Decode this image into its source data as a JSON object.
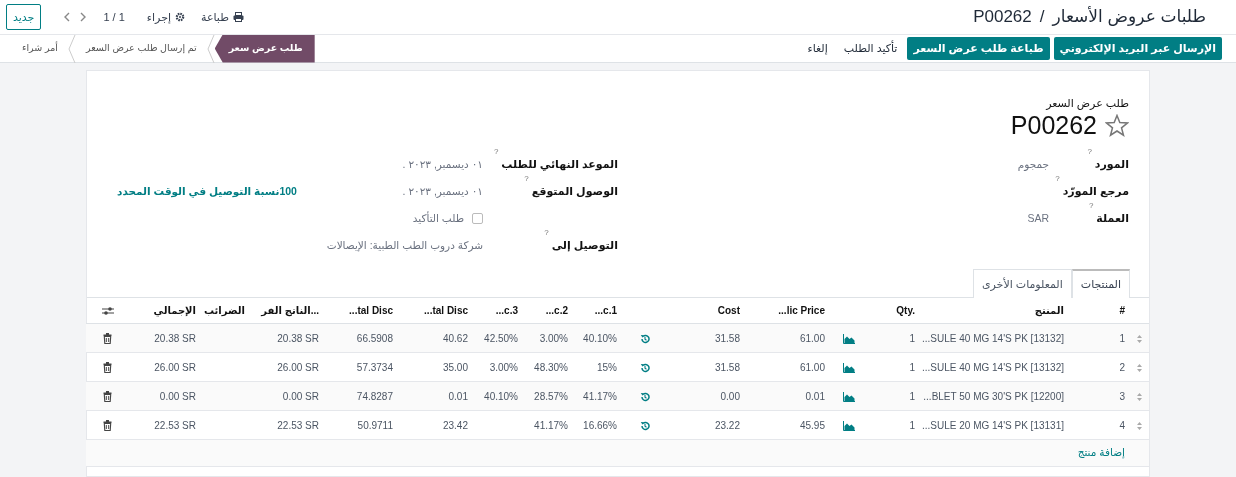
{
  "breadcrumb": {
    "parent": "طلبات عروض الأسعار",
    "separator": "/",
    "current": "P00262"
  },
  "toolbar": {
    "print": "طباعة",
    "action": "إجراء",
    "pager": "1 / 1",
    "new_button": "جديد"
  },
  "action_buttons": [
    {
      "label": "الإرسال عبر البريد الإلكتروني",
      "kind": "primary"
    },
    {
      "label": "طباعة طلب عرض السعر",
      "kind": "primary"
    },
    {
      "label": "تأكيد الطلب",
      "kind": "secondary"
    },
    {
      "label": "إلغاء",
      "kind": "secondary"
    }
  ],
  "status_steps": [
    {
      "label": "طلب عرض سعر",
      "selected": true
    },
    {
      "label": "تم إرسال طلب عرض السعر",
      "selected": false
    },
    {
      "label": "أمر شراء",
      "selected": false
    }
  ],
  "form": {
    "subtitle": "طلب عرض السعر",
    "title": "P00262",
    "starred": false,
    "right_fields": [
      {
        "label": "المورد",
        "help": "?",
        "value": "جمجوم"
      },
      {
        "label": "مرجع المورّد",
        "help": "?"
      },
      {
        "label": "العملة",
        "help": "?",
        "value": "SAR"
      }
    ],
    "left_fields": [
      {
        "kind": "text",
        "label": "الموعد النهائي للطلب",
        "help": "?",
        "value": "٠١ ديسمبر, ٢٠٢٣ ."
      },
      {
        "kind": "text",
        "label": "الوصول المتوقع",
        "help": "?",
        "value": "٠١ ديسمبر, ٢٠٢٣ .",
        "stat": "100نسبة التوصيل في الوقت المحدد"
      },
      {
        "kind": "checkbox",
        "label": "طلب التأكيد",
        "checked": false
      },
      {
        "kind": "text",
        "label": "التوصيل إلى",
        "help": "?",
        "value": "شركة دروب الطب الطبية: الإيصالات"
      }
    ]
  },
  "tabs": [
    {
      "label": "المنتجات",
      "selected": true
    },
    {
      "label": "المعلومات الأخرى",
      "selected": false
    }
  ],
  "table": {
    "columns": [
      {
        "kind": "handle"
      },
      {
        "kind": "text",
        "label": "#"
      },
      {
        "kind": "text",
        "label": "المنتج"
      },
      {
        "kind": "text",
        "label": "Qty."
      },
      {
        "kind": "chart"
      },
      {
        "kind": "text",
        "label": "...lic Price"
      },
      {
        "kind": "text",
        "label": "Cost"
      },
      {
        "kind": "history"
      },
      {
        "kind": "text",
        "label": "...c.1"
      },
      {
        "kind": "text",
        "label": "...c.2"
      },
      {
        "kind": "text",
        "label": "...c.3"
      },
      {
        "kind": "text",
        "label": "...tal Disc"
      },
      {
        "kind": "text",
        "label": "...tal Disc"
      },
      {
        "kind": "text",
        "label": "...الناتج الفر"
      },
      {
        "kind": "text",
        "label": "الضرائب"
      },
      {
        "kind": "text",
        "label": "الإجمالي"
      },
      {
        "kind": "delete"
      }
    ],
    "rows": [
      {
        "cells": [
          "",
          "1",
          "...SULE 40 MG 14'S PK [13132]",
          "1",
          "",
          "61.00",
          "31.58",
          "",
          "40.10%",
          "3.00%",
          "42.50%",
          "40.62",
          "66.5908",
          "20.38 SR",
          "",
          "20.38 SR",
          ""
        ]
      },
      {
        "cells": [
          "",
          "2",
          "...SULE 40 MG 14'S PK [13132]",
          "1",
          "",
          "61.00",
          "31.58",
          "",
          "15%",
          "48.30%",
          "3.00%",
          "35.00",
          "57.3734",
          "26.00 SR",
          "",
          "26.00 SR",
          ""
        ]
      },
      {
        "cells": [
          "",
          "3",
          "...BLET 50 MG 30'S PK [12200]",
          "1",
          "",
          "0.01",
          "0.00",
          "",
          "41.17%",
          "28.57%",
          "40.10%",
          "0.01",
          "74.8287",
          "0.00 SR",
          "",
          "0.00 SR",
          ""
        ]
      },
      {
        "cells": [
          "",
          "4",
          "...SULE 20 MG 14'S PK [13131]",
          "1",
          "",
          "45.95",
          "23.22",
          "",
          "16.66%",
          "41.17%",
          "",
          "23.42",
          "50.9711",
          "22.53 SR",
          "",
          "22.53 SR",
          ""
        ]
      }
    ],
    "add_line": "إضافة منتج"
  }
}
